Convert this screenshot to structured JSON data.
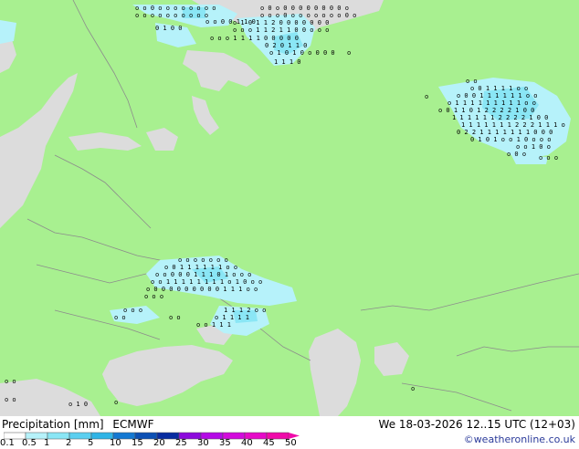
{
  "legend": {
    "title": "Precipitation [mm]",
    "model": "ECMWF",
    "ticks": [
      "0.1",
      "0.5",
      "1",
      "2",
      "5",
      "10",
      "15",
      "20",
      "25",
      "30",
      "35",
      "40",
      "45",
      "50"
    ],
    "colors": [
      "#ffffff",
      "#b6f2fa",
      "#8ae6f5",
      "#5ccff0",
      "#30b4e6",
      "#1478d2",
      "#0c50b4",
      "#082ca0",
      "#8c0adc",
      "#b40ae6",
      "#d20adc",
      "#e60ac8",
      "#f00aaa"
    ]
  },
  "valid_time": "We 18-03-2026 12..15 UTC (12+03)",
  "credit": "©weatheronline.co.uk",
  "map_colors": {
    "land": "#a8f090",
    "sea": "#dcdcdc",
    "border": "#8c8c8c",
    "precip_light": "#b6f2fa",
    "precip_mid": "#8ae6f5"
  }
}
